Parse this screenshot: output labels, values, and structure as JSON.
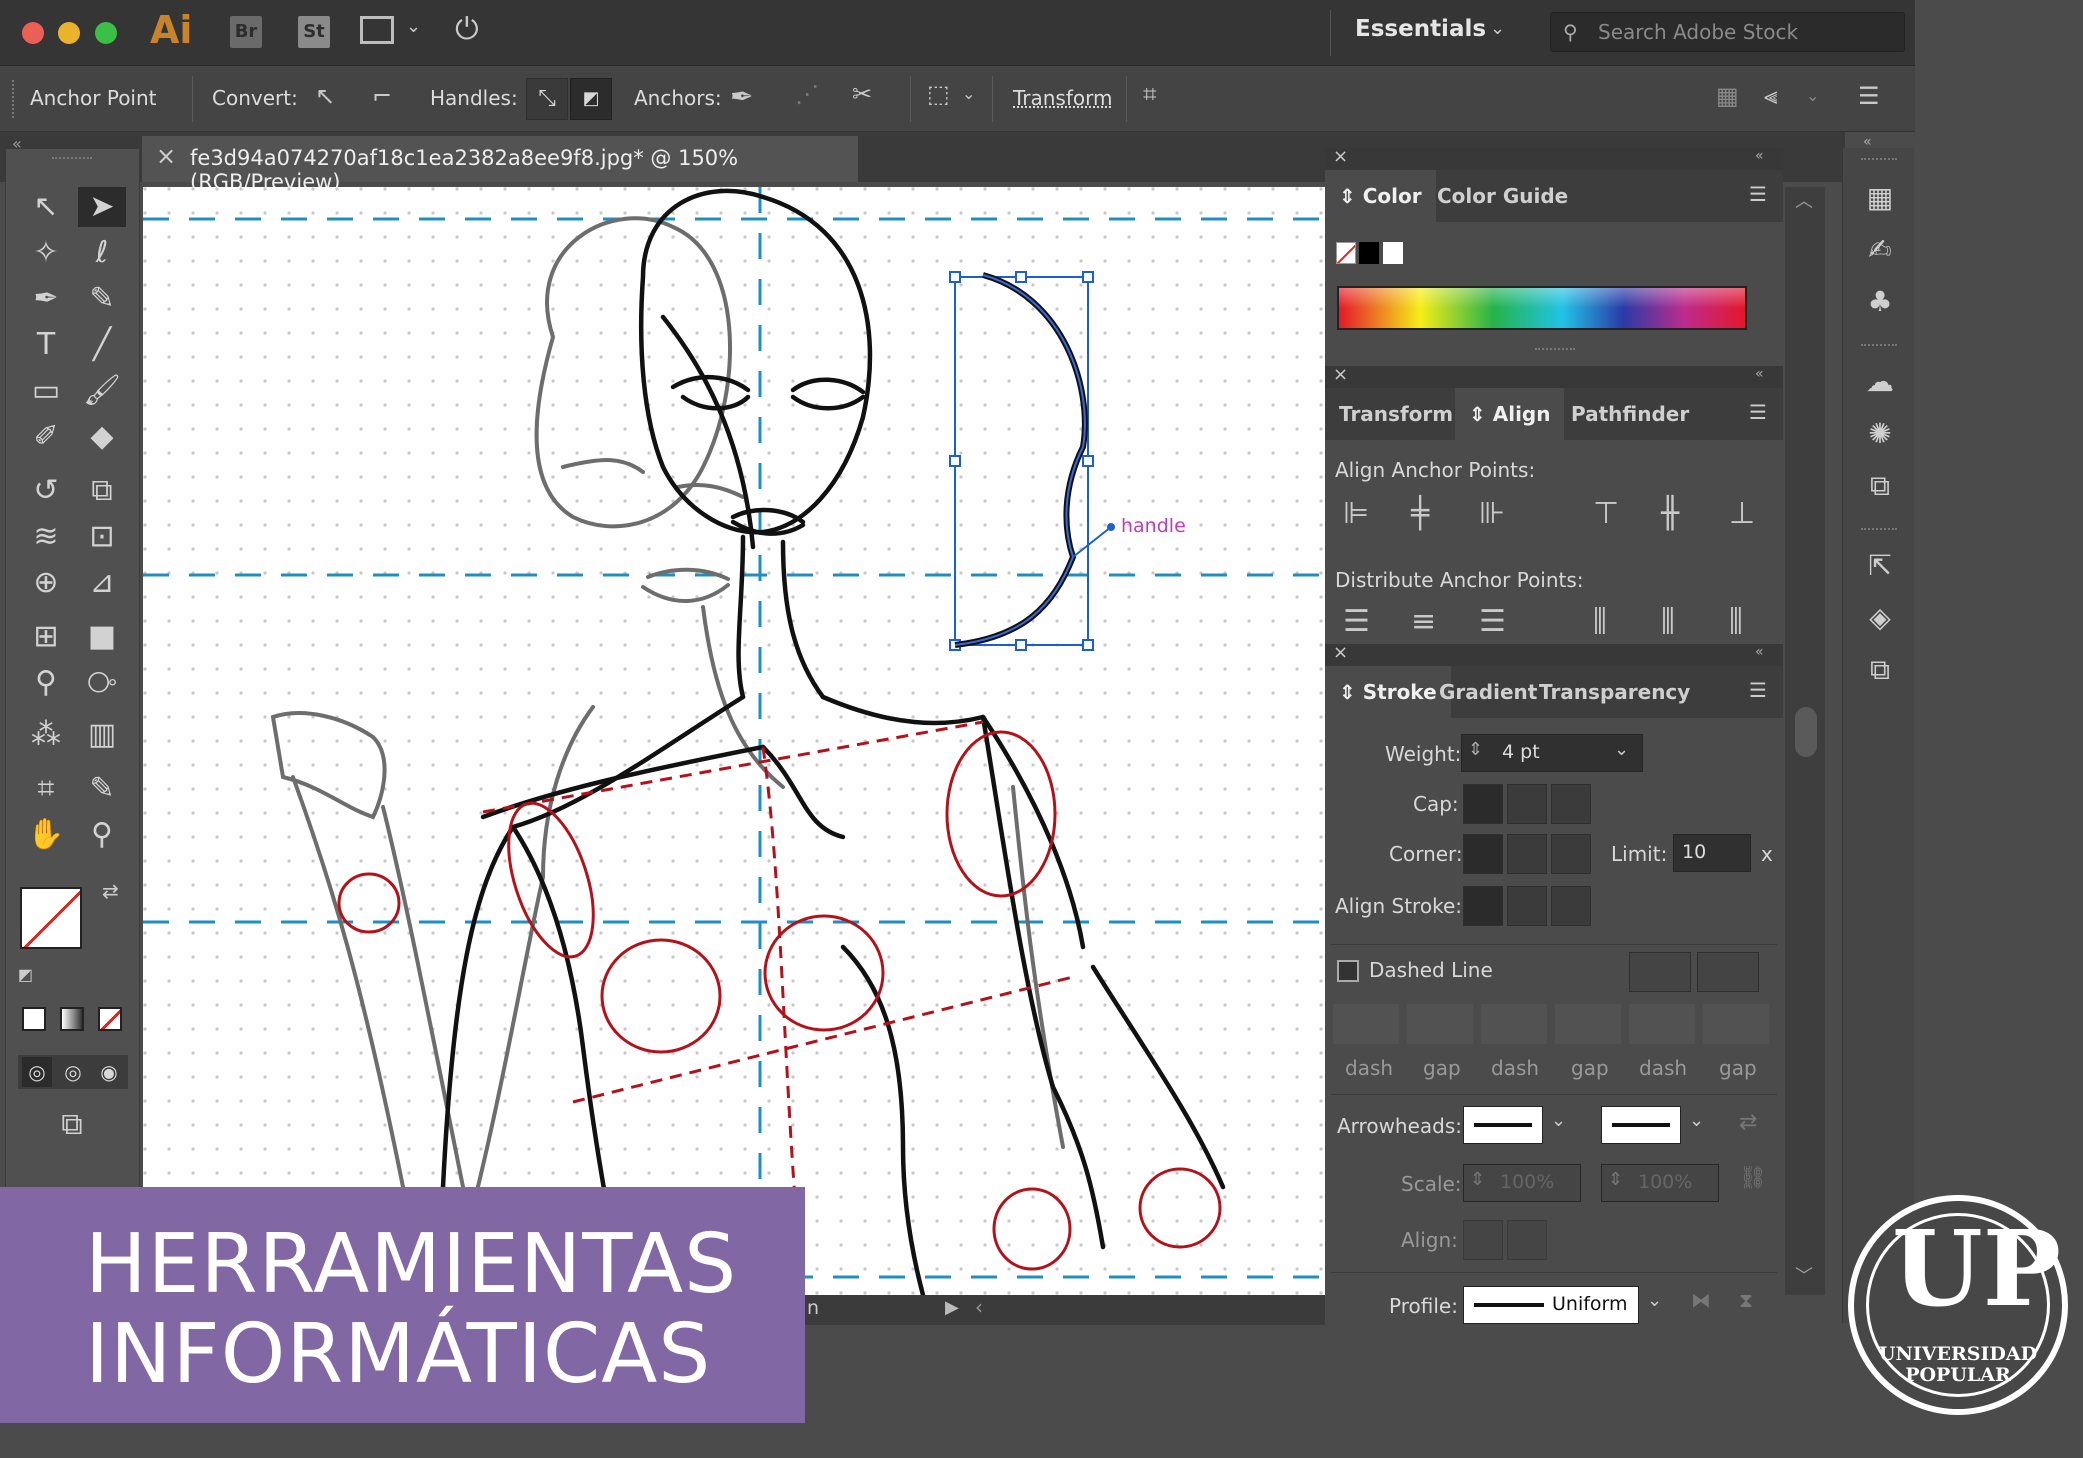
{
  "app": {
    "logo": "Ai",
    "bridge": "Br",
    "stock_icon": "St",
    "workspace": "Essentials",
    "search_placeholder": "Search Adobe Stock"
  },
  "control_bar": {
    "selection": "Anchor Point",
    "convert": "Convert:",
    "handles": "Handles:",
    "anchors": "Anchors:",
    "transform": "Transform"
  },
  "document": {
    "tab_title": "fe3d94a074270af18c1ea2382a8ee9f8.jpg* @ 150% (RGB/Preview)",
    "status_text": "n"
  },
  "canvas": {
    "handle_label": "handle"
  },
  "color_panel": {
    "tabs": [
      "Color",
      "Color Guide"
    ]
  },
  "align_panel": {
    "tabs": [
      "Transform",
      "Align",
      "Pathfinder"
    ],
    "align_anchor": "Align Anchor Points:",
    "distribute_anchor": "Distribute Anchor Points:"
  },
  "stroke_panel": {
    "tabs": [
      "Stroke",
      "Gradient",
      "Transparency"
    ],
    "weight_label": "Weight:",
    "weight_value": "4 pt",
    "cap_label": "Cap:",
    "corner_label": "Corner:",
    "limit_label": "Limit:",
    "limit_value": "10",
    "limit_unit": "x",
    "align_stroke_label": "Align Stroke:",
    "dashed_line": "Dashed Line",
    "dash_labels": [
      "dash",
      "gap",
      "dash",
      "gap",
      "dash",
      "gap"
    ],
    "arrowheads_label": "Arrowheads:",
    "scale_label": "Scale:",
    "scale_a": "100%",
    "scale_b": "100%",
    "align_label": "Align:",
    "profile_label": "Profile:",
    "profile_value": "Uniform"
  },
  "banner": {
    "line1": "HERRAMIENTAS",
    "line2": "INFORMÁTICAS"
  },
  "logo": {
    "mark": "UP",
    "line1": "UNIVERSIDAD",
    "line2": "POPULAR"
  },
  "colors": {
    "accent_banner": "#8167a3",
    "guide": "#1f8fc2",
    "figure_red": "#b3121a"
  }
}
